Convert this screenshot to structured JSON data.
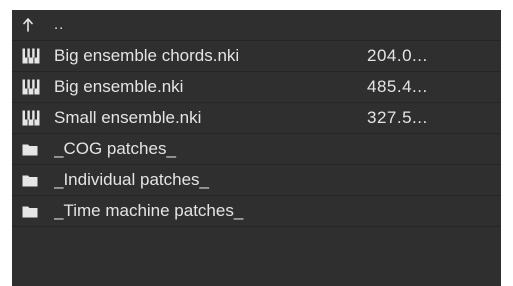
{
  "parent_row": {
    "label": ".."
  },
  "files": [
    {
      "name": "Big ensemble chords.nki",
      "size": "204.0...",
      "icon": "instrument-icon"
    },
    {
      "name": "Big ensemble.nki",
      "size": "485.4...",
      "icon": "instrument-icon"
    },
    {
      "name": "Small ensemble.nki",
      "size": "327.5...",
      "icon": "instrument-icon"
    }
  ],
  "folders": [
    {
      "name": "_COG patches_",
      "icon": "folder-icon"
    },
    {
      "name": "_Individual patches_",
      "icon": "folder-icon"
    },
    {
      "name": "_Time machine patches_",
      "icon": "folder-icon"
    }
  ]
}
